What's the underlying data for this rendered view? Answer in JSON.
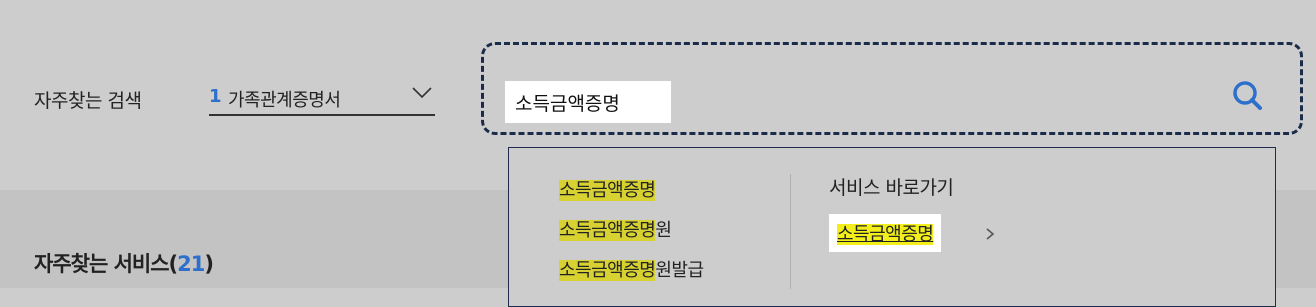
{
  "frequent_search": {
    "label": "자주찾는 검색",
    "selected_rank": "1",
    "selected_term": "가족관계증명서"
  },
  "search": {
    "value": "소득금액증명",
    "search_icon": "search-icon"
  },
  "autocomplete": {
    "suggestions": [
      {
        "highlight": "소득금액증명",
        "rest": ""
      },
      {
        "highlight": "소득금액증명",
        "rest": "원"
      },
      {
        "highlight": "소득금액증명",
        "rest": "원발급"
      }
    ],
    "shortcut_heading": "서비스 바로가기",
    "shortcut_link": "소득금액증명",
    "shortcut_icon": "chevron-right-icon"
  },
  "frequent_services": {
    "title": "자주찾는 서비스(",
    "count": "21",
    "close": ")"
  },
  "colors": {
    "accent": "#2d6fcb",
    "highlight": "#d7d232",
    "link_highlight": "#f2ef1c"
  }
}
